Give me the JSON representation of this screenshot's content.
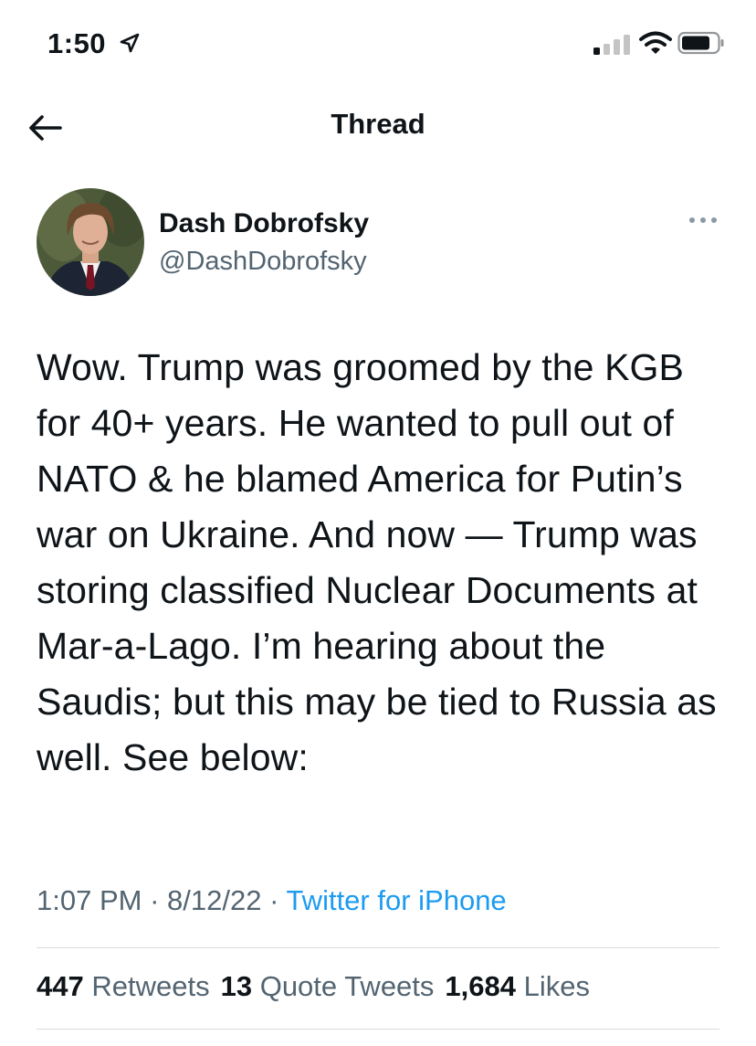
{
  "status_bar": {
    "time": "1:50",
    "location_icon": "location-arrow-icon",
    "signal_icon": "cellular-signal-icon",
    "wifi_icon": "wifi-icon",
    "battery_icon": "battery-icon"
  },
  "nav": {
    "title": "Thread",
    "back_icon": "back-arrow-icon"
  },
  "author": {
    "name": "Dash Dobrofsky",
    "handle": "@DashDobrofsky",
    "more_icon": "more-options-icon"
  },
  "tweet": {
    "text": "Wow. Trump was groomed by the KGB for 40+ years. He wanted to pull out of NATO & he blamed America for Putin’s war on Ukraine. And now — Trump was storing classified Nuclear Documents at Mar-a-Lago. I’m hearing about the Saudis; but this may be tied to Russia as well. See below:",
    "time": "1:07 PM",
    "date": "8/12/22",
    "source": "Twitter for iPhone"
  },
  "stats": {
    "retweets_count": "447",
    "retweets_label": "Retweets",
    "quotes_count": "13",
    "quotes_label": "Quote Tweets",
    "likes_count": "1,684",
    "likes_label": "Likes"
  },
  "colors": {
    "link": "#1d9bf0",
    "secondary": "#536471",
    "text": "#0f1419",
    "divider": "#d7dbdf"
  }
}
